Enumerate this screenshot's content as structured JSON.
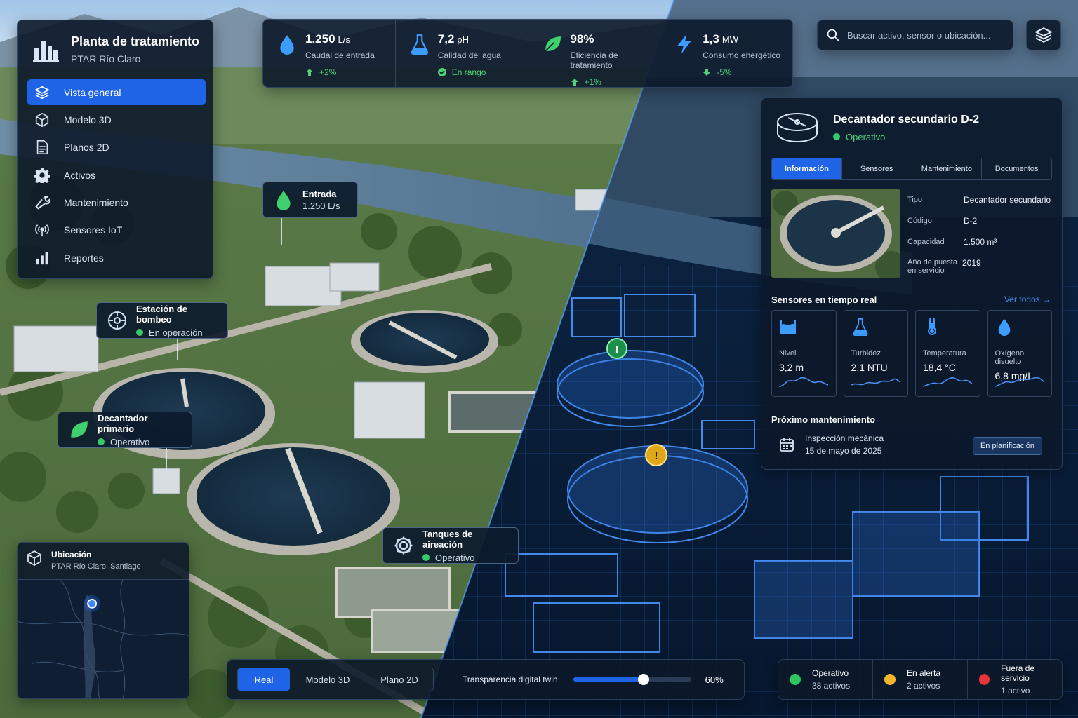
{
  "sidebar": {
    "title": "Planta de tratamiento",
    "subtitle": "PTAR Río Claro",
    "items": [
      {
        "label": "Vista general",
        "icon": "layers-icon"
      },
      {
        "label": "Modelo 3D",
        "icon": "cube-icon"
      },
      {
        "label": "Planos 2D",
        "icon": "document-icon"
      },
      {
        "label": "Activos",
        "icon": "gear-icon"
      },
      {
        "label": "Mantenimiento",
        "icon": "wrench-icon"
      },
      {
        "label": "Sensores IoT",
        "icon": "antenna-icon"
      },
      {
        "label": "Reportes",
        "icon": "bar-chart-icon"
      }
    ]
  },
  "kpis": [
    {
      "value": "1.250",
      "unit": "L/s",
      "label": "Caudal de entrada",
      "delta": "+2%",
      "icon": "water-drop-icon"
    },
    {
      "value": "7,2",
      "unit": "pH",
      "label": "Calidad del agua",
      "delta": "En rango",
      "icon": "flask-icon"
    },
    {
      "value": "98%",
      "unit": "",
      "label": "Eficiencia de tratamiento",
      "delta": "+1%",
      "icon": "leaf-icon"
    },
    {
      "value": "1,3",
      "unit": "MW",
      "label": "Consumo energético",
      "delta": "-5%",
      "icon": "lightning-icon"
    }
  ],
  "search": {
    "placeholder": "Buscar activo, sensor o ubicación..."
  },
  "callouts": {
    "entrada": {
      "title": "Entrada",
      "sub": "1.250 L/s"
    },
    "bombeo": {
      "title": "Estación de bombeo",
      "sub": "En operación"
    },
    "primario": {
      "title": "Decantador primario",
      "sub": "Operativo"
    },
    "aireacion": {
      "title": "Tanques de aireación",
      "sub": "Operativo"
    }
  },
  "detail": {
    "title": "Decantador secundario D-2",
    "status": "Operativo",
    "tabs": [
      "Información",
      "Sensores",
      "Mantenimiento",
      "Documentos"
    ],
    "info": [
      {
        "k": "Tipo",
        "v": "Decantador secundario"
      },
      {
        "k": "Código",
        "v": "D-2"
      },
      {
        "k": "Capacidad",
        "v": "1.500 m³"
      },
      {
        "k": "Año de puesta en servicio",
        "v": "2019"
      }
    ],
    "sensors_title": "Sensores en tiempo real",
    "see_all": "Ver todos →",
    "sensors": [
      {
        "label": "Nivel",
        "value": "3,2 m",
        "icon": "tank-level-icon"
      },
      {
        "label": "Turbidez",
        "value": "2,1 NTU",
        "icon": "flask-icon"
      },
      {
        "label": "Temperatura",
        "value": "18,4 °C",
        "icon": "thermometer-icon"
      },
      {
        "label": "Oxígeno disuelto",
        "value": "6,8 mg/L",
        "icon": "water-drop-icon"
      }
    ],
    "maint_title": "Próximo mantenimiento",
    "maint_task": "Inspección mecánica",
    "maint_date": "15 de mayo de 2025",
    "maint_badge": "En planificación"
  },
  "location": {
    "title": "Ubicación",
    "sub": "PTAR Río Claro, Santiago"
  },
  "views": {
    "buttons": [
      "Real",
      "Modelo 3D",
      "Plano 2D"
    ],
    "active": "Real",
    "slider_label": "Transparencia digital twin",
    "slider_value": 60,
    "slider_text": "60%"
  },
  "legend": [
    {
      "title": "Operativo",
      "count": "38 activos",
      "color": "#2ec45e"
    },
    {
      "title": "En alerta",
      "count": "2 activos",
      "color": "#f4b62a"
    },
    {
      "title": "Fuera de servicio",
      "count": "1 activo",
      "color": "#e8343b"
    }
  ],
  "colors": {
    "accent": "#1f63e6",
    "ok": "#38c96b",
    "alert": "#f4b62a",
    "error": "#e8343b",
    "twin": "#3d8cff"
  }
}
